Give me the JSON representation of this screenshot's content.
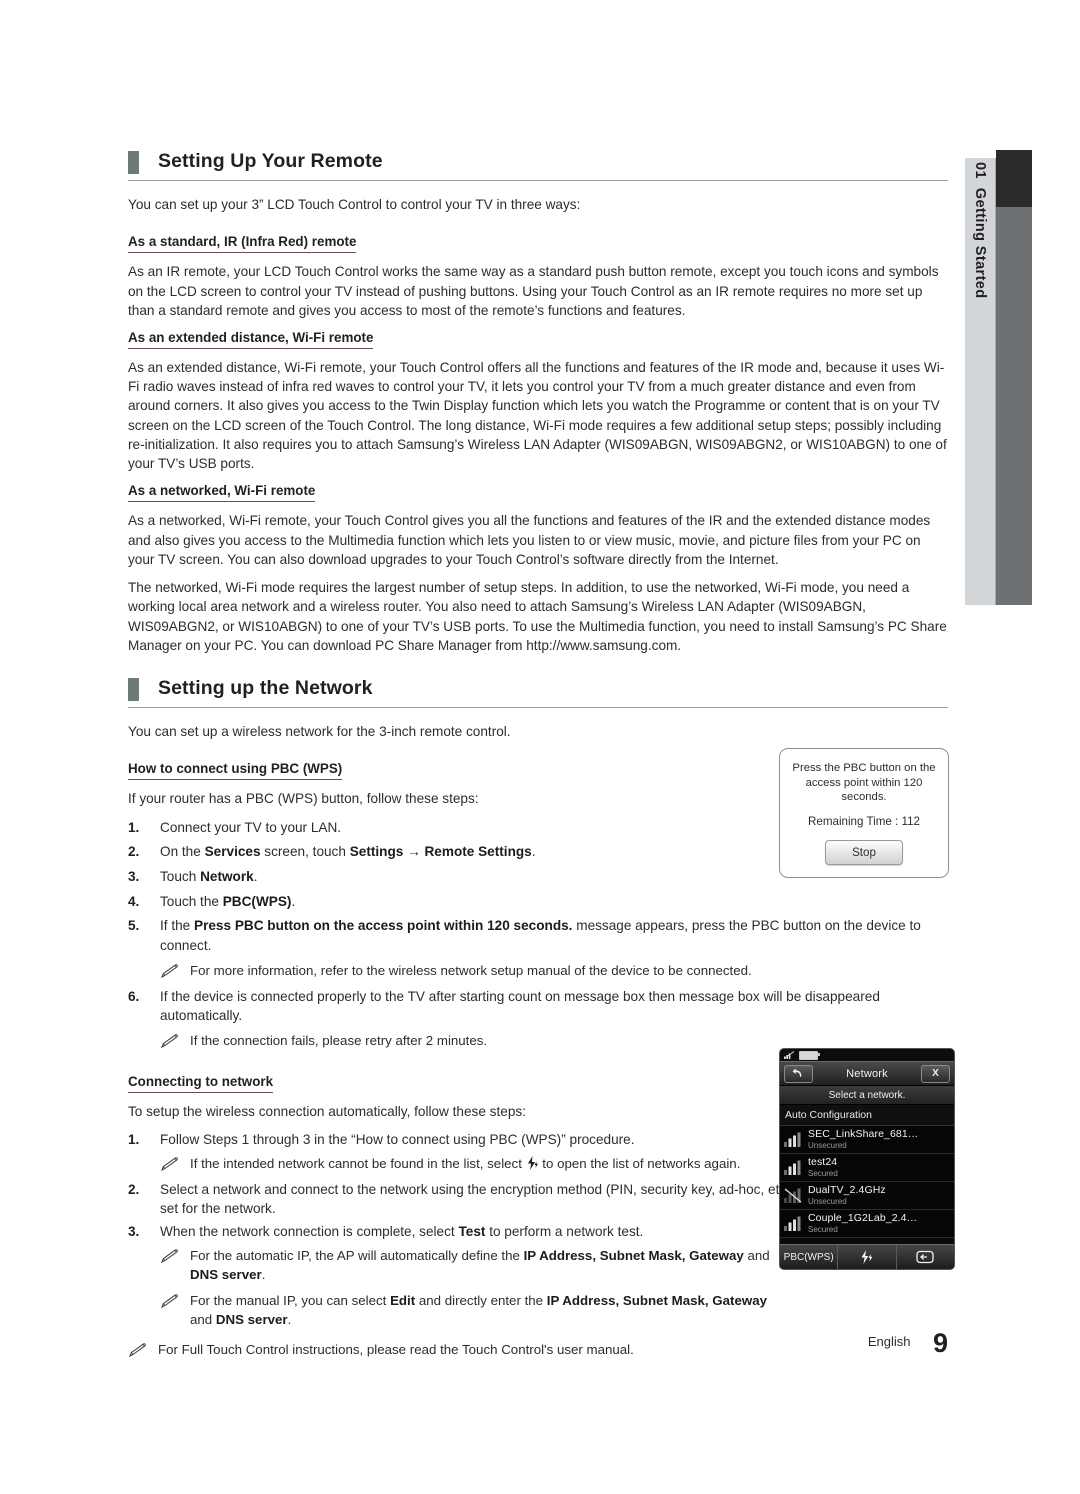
{
  "chapter_tab": {
    "number": "01",
    "label": "Getting Started"
  },
  "sections": [
    {
      "heading": "Setting Up Your Remote",
      "lead": "You can set up your 3” LCD Touch Control to control your TV in three ways:",
      "subsections": [
        {
          "sub_head": "As a standard, IR (Infra Red) remote",
          "paragraphs": [
            "As an IR remote, your LCD Touch Control works the same way as a standard push button remote, except you touch icons and symbols on the LCD screen to control your TV instead of pushing buttons. Using your Touch Control as an IR remote requires no more set up than a standard remote and gives you access to most of the remote’s functions and features."
          ]
        },
        {
          "sub_head": "As an extended distance, Wi-Fi remote",
          "paragraphs": [
            "As an extended distance, Wi-Fi remote, your Touch Control offers all the functions and features of the IR mode and, because it uses Wi-Fi radio waves instead of infra red waves to control your TV, it lets you control your TV from a much greater distance and even from around corners. It also gives you access to the Twin Display function which lets you watch the Programme or content that is on your TV screen on the LCD screen of the Touch Control. The long distance, Wi-Fi mode requires a few additional setup steps; possibly including re-initialization. It also requires you to attach Samsung’s Wireless LAN Adapter (WIS09ABGN, WIS09ABGN2, or WIS10ABGN) to one of your TV’s USB ports."
          ]
        },
        {
          "sub_head": "As a networked, Wi-Fi remote",
          "paragraphs": [
            "As a networked, Wi-Fi remote, your Touch Control gives you all the functions and features of the IR and the extended distance modes and also gives you access to the Multimedia function which lets you listen to or view music, movie, and picture files from your PC on your TV screen. You can also download upgrades to your Touch Control’s software directly from the Internet.",
            "The networked, Wi-Fi mode requires the largest number of setup steps. In addition, to use the networked, Wi-Fi mode, you need a working local area network and a wireless router. You also need to attach Samsung’s Wireless LAN Adapter (WIS09ABGN, WIS09ABGN2, or WIS10ABGN) to one of your TV’s USB ports. To use the Multimedia function, you need to install Samsung’s PC Share Manager on your PC. You can download PC Share Manager from http://www.samsung.com."
          ]
        }
      ]
    },
    {
      "heading": "Setting up the Network",
      "lead": "You can set up a wireless network for the 3-inch remote control.",
      "pbc": {
        "sub_head": "How to connect using PBC (WPS)",
        "intro": "If your router has a PBC (WPS) button, follow these steps:",
        "steps": [
          {
            "num": "1.",
            "text": "Connect your TV to your LAN."
          },
          {
            "num": "2.",
            "text": "On the Services screen, touch Settings → Remote Settings."
          },
          {
            "num": "3.",
            "text": "Touch Network."
          },
          {
            "num": "4.",
            "text": "Touch the PBC(WPS)."
          },
          {
            "num": "5.",
            "text": "If the Press PBC button on the access point within 120 seconds. message appears, press the PBC button on the device to connect."
          },
          {
            "num": "6.",
            "text": "If the device is connected properly to the TV after starting count on message box then message box will be disappeared automatically."
          }
        ],
        "note_after_5": "For more information, refer to the wireless network setup manual of the device to be connected.",
        "note_after_6": "If the connection fails, please retry after 2 minutes."
      },
      "connecting": {
        "sub_head": "Connecting to network",
        "intro": "To setup the wireless connection automatically, follow these steps:",
        "steps": [
          {
            "num": "1.",
            "text": "Follow Steps 1 through 3 in the “How to connect using PBC (WPS)” procedure."
          },
          {
            "num": "2.",
            "text": "Select a network and connect to the network using the encryption method (PIN, security key, ad-hoc, etc.) set for the network."
          },
          {
            "num": "3.",
            "text": "When the network connection is complete, select Test to perform a network test."
          }
        ],
        "note_step1": "If the intended network cannot be found in the list, select ⚡ to open the list of networks again.",
        "note_auto_ip": "For the automatic IP, the AP will automatically define the IP Address, Subnet Mask, Gateway and DNS server.",
        "note_manual_ip": "For the manual IP, you can select Edit and directly enter the IP Address, Subnet Mask, Gateway and DNS server.",
        "note_full_touch": "For Full Touch Control instructions, please read the Touch Control's user manual."
      }
    }
  ],
  "pbc_dialog": {
    "message": "Press the PBC button on the access point within 120 seconds.",
    "remaining_label": "Remaining Time :",
    "remaining_value": "112",
    "stop_label": "Stop"
  },
  "device": {
    "title": "Network",
    "back_icon": "back-arrow-icon",
    "close_label": "X",
    "subtitle": "Select a network.",
    "auto_config_label": "Auto Configuration",
    "networks": [
      {
        "ssid": "SEC_LinkShare_681…",
        "security": "Unsecured",
        "strength": 3
      },
      {
        "ssid": "test24",
        "security": "Secured",
        "strength": 3
      },
      {
        "ssid": "DualTV_2.4GHz",
        "security": "Unsecured",
        "strength": 0
      },
      {
        "ssid": "Couple_1G2Lab_2.4…",
        "security": "Secured",
        "strength": 3
      }
    ],
    "bottom_bar": {
      "pbc_label": "PBC(WPS)",
      "refresh_icon": "lightning-refresh-icon",
      "input_icon": "enter-input-icon"
    }
  },
  "footer": {
    "language": "English",
    "page_number": "9"
  },
  "colors": {
    "section_marker": "#6c7b76",
    "sub_head_rule": "#6b4b4b",
    "tab_light": "#d3d6d8",
    "tab_dark": "#2b2b2b",
    "tab_gray": "#6e7174"
  }
}
